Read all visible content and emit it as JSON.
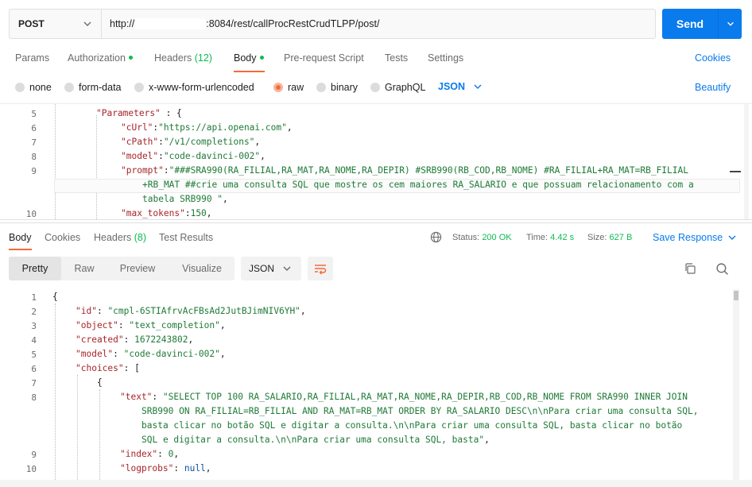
{
  "request": {
    "method": "POST",
    "url_prefix": "http://",
    "url_suffix": ":8084/rest/callProcRestCrudTLPP/post/",
    "send_label": "Send"
  },
  "tabs": [
    {
      "label": "Params"
    },
    {
      "label": "Authorization"
    },
    {
      "label": "Headers",
      "count": "(12)"
    },
    {
      "label": "Body"
    },
    {
      "label": "Pre-request Script"
    },
    {
      "label": "Tests"
    },
    {
      "label": "Settings"
    }
  ],
  "cookies_label": "Cookies",
  "body_types": [
    "none",
    "form-data",
    "x-www-form-urlencoded",
    "raw",
    "binary",
    "GraphQL"
  ],
  "body_format": "JSON",
  "beautify_label": "Beautify",
  "request_body": {
    "line_numbers": [
      "5",
      "6",
      "7",
      "8",
      "9",
      "10"
    ],
    "l5": {
      "key": "\"Parameters\"",
      "rest": " : {"
    },
    "l6": {
      "key": "\"cUrl\"",
      "val": "\"https://api.openai.com\""
    },
    "l7": {
      "key": "\"cPath\"",
      "val": "\"/v1/completions\""
    },
    "l8": {
      "key": "\"model\"",
      "val": "\"code-davinci-002\""
    },
    "l9": {
      "key": "\"prompt\"",
      "val_a": "\"###SRA990(RA_FILIAL,RA_MAT,RA_NOME,RA_DEPIR) #SRB990(RB_COD,RB_NOME) #RA_FILIAL+RA_MAT=RB_FILIAL",
      "val_b": "+RB_MAT ##crie uma consulta SQL que mostre os cem maiores RA_SALARIO e que possuam relacionamento com a",
      "val_c": "tabela SRB990 \""
    },
    "l10": {
      "key": "\"max_tokens\"",
      "val": "150"
    }
  },
  "response_tabs": [
    {
      "label": "Body"
    },
    {
      "label": "Cookies"
    },
    {
      "label": "Headers",
      "count": "(8)"
    },
    {
      "label": "Test Results"
    }
  ],
  "status": {
    "status_label": "Status:",
    "status_value": "200 OK",
    "time_label": "Time:",
    "time_value": "4.42 s",
    "size_label": "Size:",
    "size_value": "627 B"
  },
  "save_response_label": "Save Response",
  "view_modes": [
    "Pretty",
    "Raw",
    "Preview",
    "Visualize"
  ],
  "response_format": "JSON",
  "response_body": {
    "line_numbers": [
      "1",
      "2",
      "3",
      "4",
      "5",
      "6",
      "7",
      "8",
      "9",
      "10"
    ],
    "l1": "{",
    "l2": {
      "key": "\"id\"",
      "val": "\"cmpl-6STIAfrvAcFBsAd2JutBJimNIV6YH\""
    },
    "l3": {
      "key": "\"object\"",
      "val": "\"text_completion\""
    },
    "l4": {
      "key": "\"created\"",
      "val": "1672243802"
    },
    "l5": {
      "key": "\"model\"",
      "val": "\"code-davinci-002\""
    },
    "l6": {
      "key": "\"choices\"",
      "val": "["
    },
    "l7": "{",
    "l8": {
      "key": "\"text\"",
      "val_a": "\"SELECT TOP 100 RA_SALARIO,RA_FILIAL,RA_MAT,RA_NOME,RA_DEPIR,RB_COD,RB_NOME FROM SRA990 INNER JOIN",
      "val_b": "SRB990 ON RA_FILIAL=RB_FILIAL AND RA_MAT=RB_MAT ORDER BY RA_SALARIO DESC\\n\\nPara criar uma consulta SQL,",
      "val_c": "basta clicar no botão SQL e digitar a consulta.\\n\\nPara criar uma consulta SQL, basta clicar no botão",
      "val_d": "SQL e digitar a consulta.\\n\\nPara criar uma consulta SQL, basta\""
    },
    "l9": {
      "key": "\"index\"",
      "val": "0"
    },
    "l10": {
      "key": "\"logprobs\"",
      "val": "null"
    }
  }
}
